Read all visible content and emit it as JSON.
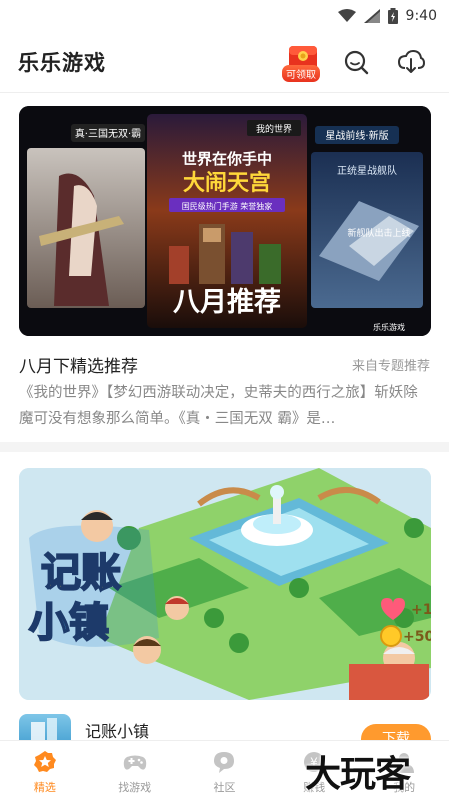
{
  "status_bar": {
    "time": "9:40",
    "icons": [
      "wifi-icon",
      "signal-icon",
      "battery-icon"
    ]
  },
  "header": {
    "title": "乐乐游戏",
    "gift_badge": "可领取",
    "icons": [
      "gift-icon",
      "search-icon",
      "download-icon"
    ]
  },
  "feature_card": {
    "banner": {
      "left_tag": "真·三国无双·霸",
      "center_tag": "我的世界",
      "center_headline_1": "世界在你手中",
      "center_headline_2": "大闹天宫",
      "center_sub": "国民级热门手游 荣誉独家",
      "center_title": "八月推荐",
      "right_tag": "星战前线·新版",
      "right_caption": "正统星战舰队",
      "right_caption_2": "新舰队出击上线",
      "brand": "乐乐游戏"
    },
    "title": "八月下精选推荐",
    "source": "来自专题推荐",
    "description": "《我的世界》【梦幻西游联动决定，史蒂夫的西行之旅】斩妖除魔可没有想象那么简单。《真・三国无双 霸》是…"
  },
  "game_card": {
    "banner": {
      "logo_line_1": "记账",
      "logo_line_2": "小镇",
      "heart_reward": "+1",
      "coin_reward": "+50"
    },
    "name": "记账小镇",
    "download_label": "下载"
  },
  "bottom_nav": [
    {
      "label": "精选",
      "icon": "star-badge-icon",
      "active": true
    },
    {
      "label": "找游戏",
      "icon": "gamepad-icon",
      "active": false
    },
    {
      "label": "社区",
      "icon": "chat-bubble-icon",
      "active": false
    },
    {
      "label": "赚钱",
      "icon": "coin-icon",
      "active": false
    },
    {
      "label": "我的",
      "icon": "user-icon",
      "active": false
    }
  ],
  "watermark": "大玩客",
  "colors": {
    "accent": "#ff8a1f",
    "download": "#ff9a2e",
    "badge": "#e8321e"
  }
}
